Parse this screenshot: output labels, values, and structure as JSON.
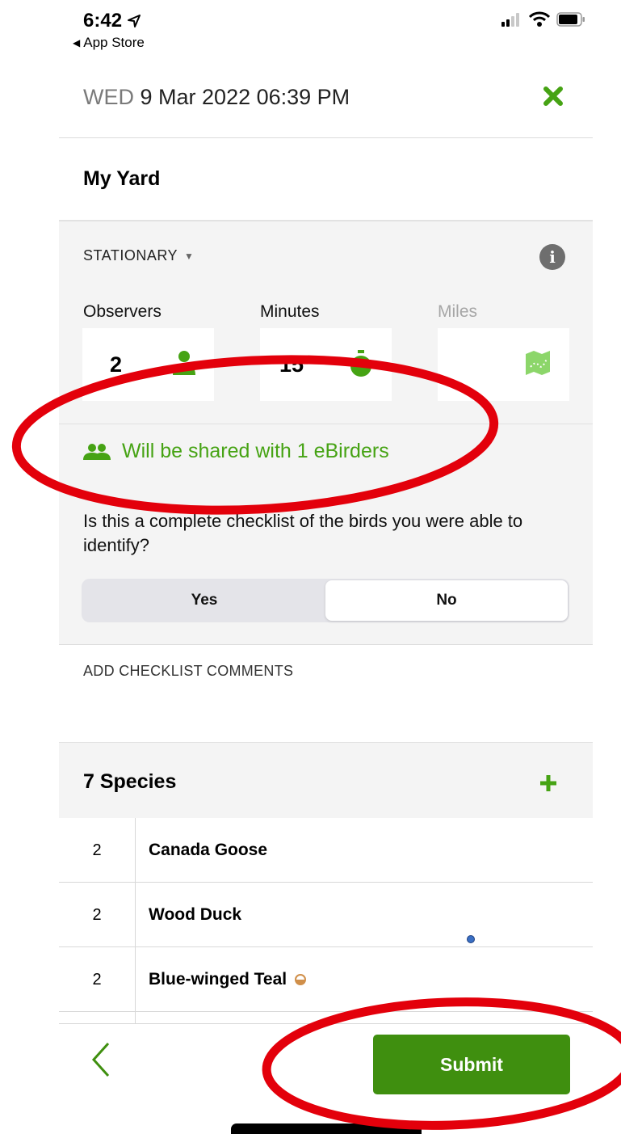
{
  "status_bar": {
    "time": "6:42",
    "back_label": "App Store"
  },
  "header": {
    "day": "WED",
    "datetime": "9 Mar 2022 06:39 PM"
  },
  "location": "My Yard",
  "effort": {
    "protocol": "STATIONARY",
    "fields": [
      {
        "label": "Observers",
        "value": "2",
        "icon": "person-icon"
      },
      {
        "label": "Minutes",
        "value": "15",
        "icon": "stopwatch-icon"
      },
      {
        "label": "Miles",
        "value": "",
        "icon": "map-icon"
      }
    ],
    "share_text": "Will be shared with 1 eBirders",
    "question": "Is this a complete checklist of the birds you were able to identify?",
    "options": [
      "Yes",
      "No"
    ],
    "selected_option": "No"
  },
  "comments_label": "ADD CHECKLIST COMMENTS",
  "species": {
    "count_label": "7 Species",
    "rows": [
      {
        "count": "2",
        "name": "Canada Goose"
      },
      {
        "count": "2",
        "name": "Wood Duck"
      },
      {
        "count": "2",
        "name": "Blue-winged Teal",
        "badge": "half-circle-icon"
      }
    ]
  },
  "footer": {
    "submit_label": "Submit"
  },
  "colors": {
    "accent_green": "#46a314",
    "submit_green": "#3f8f0f",
    "annotation_red": "#e3000b"
  }
}
